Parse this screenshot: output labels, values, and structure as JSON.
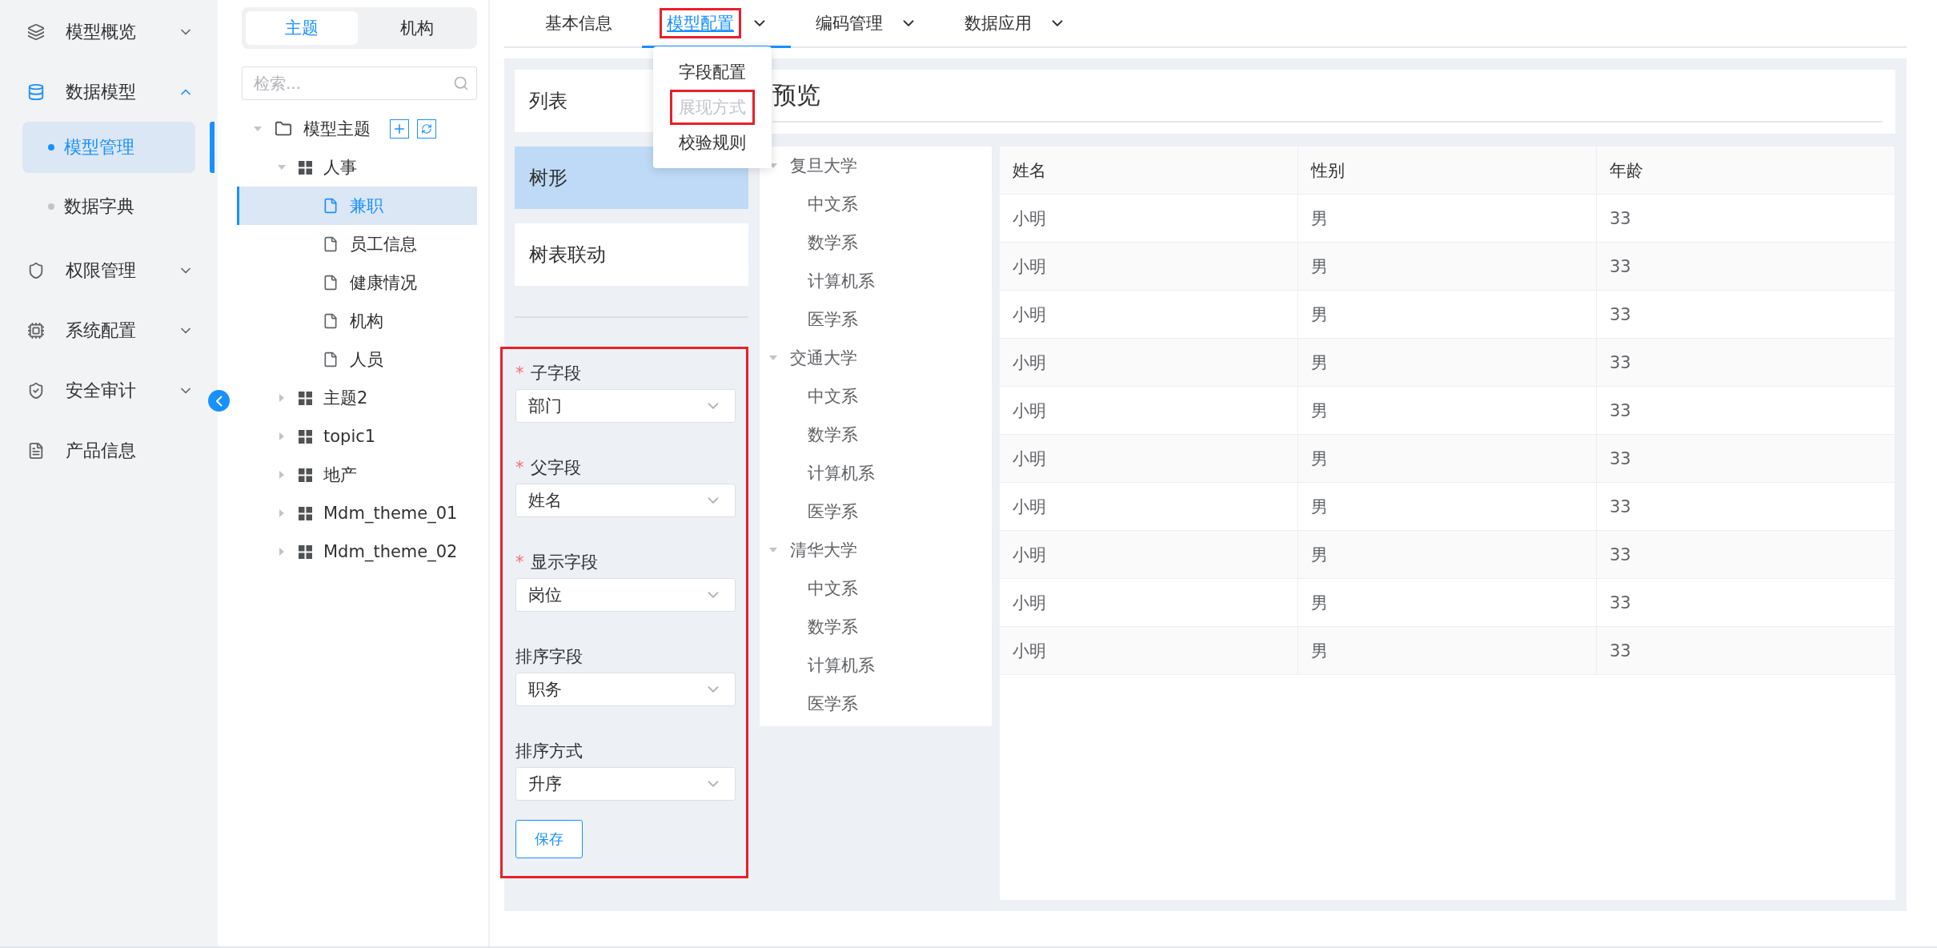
{
  "sidebar": {
    "items": [
      {
        "label": "模型概览",
        "kind": "group",
        "expanded": false
      },
      {
        "label": "数据模型",
        "kind": "group",
        "expanded": true,
        "selected": true,
        "children": [
          {
            "label": "模型管理",
            "selected": true
          },
          {
            "label": "数据字典",
            "selected": false
          }
        ]
      },
      {
        "label": "权限管理",
        "kind": "group",
        "expanded": false
      },
      {
        "label": "系统配置",
        "kind": "group",
        "expanded": false
      },
      {
        "label": "安全审计",
        "kind": "group",
        "expanded": false
      },
      {
        "label": "产品信息",
        "kind": "link"
      }
    ]
  },
  "tree_panel": {
    "tabs": [
      {
        "label": "主题",
        "selected": true
      },
      {
        "label": "机构",
        "selected": false
      }
    ],
    "search": {
      "placeholder": "检索..."
    },
    "tree": [
      {
        "label": "模型主题",
        "expanded": true,
        "children": [
          {
            "label": "人事",
            "expanded": true,
            "children": [
              {
                "label": "兼职",
                "selected": true
              },
              {
                "label": "员工信息",
                "selected": false
              },
              {
                "label": "健康情况",
                "selected": false
              },
              {
                "label": "机构",
                "selected": false
              },
              {
                "label": "人员",
                "selected": false
              }
            ]
          },
          {
            "label": "主题2",
            "expanded": false
          },
          {
            "label": "topic1",
            "expanded": false
          },
          {
            "label": "地产",
            "expanded": false
          },
          {
            "label": "Mdm_theme_01",
            "expanded": false
          },
          {
            "label": "Mdm_theme_02",
            "expanded": false
          }
        ]
      }
    ]
  },
  "tabs": [
    {
      "label": "基本信息",
      "selected": false,
      "dropdown": false,
      "highlighted": false
    },
    {
      "label": "模型配置",
      "selected": true,
      "dropdown": true,
      "highlighted": true
    },
    {
      "label": "编码管理",
      "selected": false,
      "dropdown": true,
      "highlighted": false
    },
    {
      "label": "数据应用",
      "selected": false,
      "dropdown": true,
      "highlighted": false
    }
  ],
  "tab_menu": {
    "items": [
      {
        "label": "字段配置",
        "disabled": false,
        "highlighted": false
      },
      {
        "label": "展现方式",
        "disabled": true,
        "highlighted": true
      },
      {
        "label": "校验规则",
        "disabled": false,
        "highlighted": false
      }
    ]
  },
  "display_modes": [
    {
      "label": "列表",
      "selected": false
    },
    {
      "label": "树形",
      "selected": true
    },
    {
      "label": "树表联动",
      "selected": false
    }
  ],
  "form": {
    "highlighted": true,
    "required_mark": "*",
    "fields": [
      {
        "label": "子字段",
        "required": true,
        "value": "部门"
      },
      {
        "label": "父字段",
        "required": true,
        "value": "姓名"
      },
      {
        "label": "显示字段",
        "required": true,
        "value": "岗位"
      },
      {
        "label": "排序字段",
        "required": false,
        "value": "职务"
      },
      {
        "label": "排序方式",
        "required": false,
        "value": "升序"
      }
    ],
    "save_button": "保存"
  },
  "preview": {
    "title": "预览",
    "tree": [
      {
        "label": "复旦大学",
        "expanded": true,
        "children": [
          {
            "label": "中文系"
          },
          {
            "label": "数学系"
          },
          {
            "label": "计算机系"
          },
          {
            "label": "医学系"
          }
        ]
      },
      {
        "label": "交通大学",
        "expanded": true,
        "children": [
          {
            "label": "中文系"
          },
          {
            "label": "数学系"
          },
          {
            "label": "计算机系"
          },
          {
            "label": "医学系"
          }
        ]
      },
      {
        "label": "清华大学",
        "expanded": true,
        "children": [
          {
            "label": "中文系"
          },
          {
            "label": "数学系"
          },
          {
            "label": "计算机系"
          },
          {
            "label": "医学系"
          }
        ]
      }
    ],
    "table": {
      "columns": [
        "姓名",
        "性别",
        "年龄"
      ],
      "rows": [
        [
          "小明",
          "男",
          "33"
        ],
        [
          "小明",
          "男",
          "33"
        ],
        [
          "小明",
          "男",
          "33"
        ],
        [
          "小明",
          "男",
          "33"
        ],
        [
          "小明",
          "男",
          "33"
        ],
        [
          "小明",
          "男",
          "33"
        ],
        [
          "小明",
          "男",
          "33"
        ],
        [
          "小明",
          "男",
          "33"
        ],
        [
          "小明",
          "男",
          "33"
        ],
        [
          "小明",
          "男",
          "33"
        ]
      ]
    }
  }
}
